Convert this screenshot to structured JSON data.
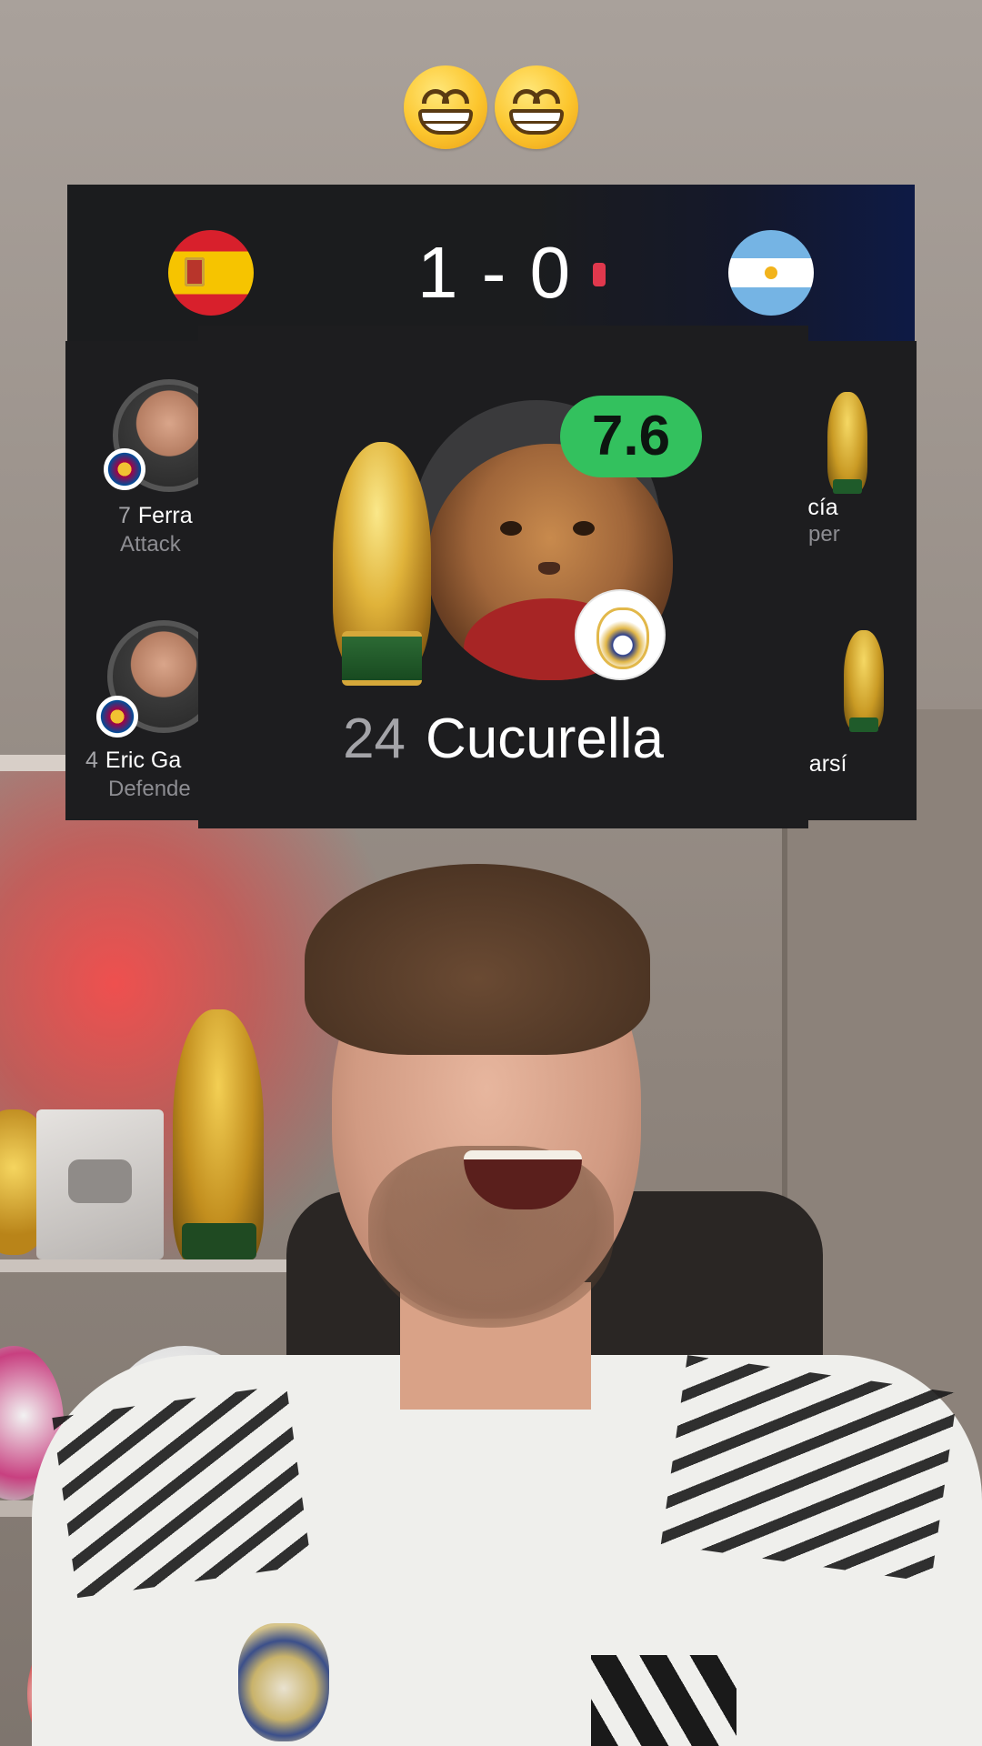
{
  "overlay": {
    "emojis": [
      {
        "icon": "grinning-face-with-smiling-eyes"
      },
      {
        "icon": "grinning-face-with-smiling-eyes"
      }
    ]
  },
  "scoreboard": {
    "home_team": {
      "flag_icon": "spain-flag",
      "colors": [
        "#d8202c",
        "#f6c400"
      ]
    },
    "away_team": {
      "flag_icon": "argentina-flag",
      "colors": [
        "#75b4e4",
        "#ffffff"
      ]
    },
    "score": "1 - 0",
    "live_indicator_color": "#e0384d"
  },
  "lineup": {
    "left_players": [
      {
        "number": "7",
        "name": "Ferra",
        "position": "Attack",
        "club_icon": "barcelona-crest"
      },
      {
        "number": "4",
        "name": "Eric Ga",
        "position": "Defende",
        "club_icon": "barcelona-crest"
      }
    ],
    "right_players": [
      {
        "name": "rcía",
        "position": "per",
        "badge_icon": "world-cup-trophy"
      },
      {
        "name": "ubarsí",
        "position": "",
        "badge_icon": "world-cup-trophy"
      }
    ]
  },
  "featured_player": {
    "number": "24",
    "name": "Cucurella",
    "rating": "7.6",
    "rating_color": "#33c15e",
    "badge_icon": "world-cup-trophy",
    "club_icon": "real-madrid-crest",
    "avatar_icon": "cat-avatar"
  }
}
